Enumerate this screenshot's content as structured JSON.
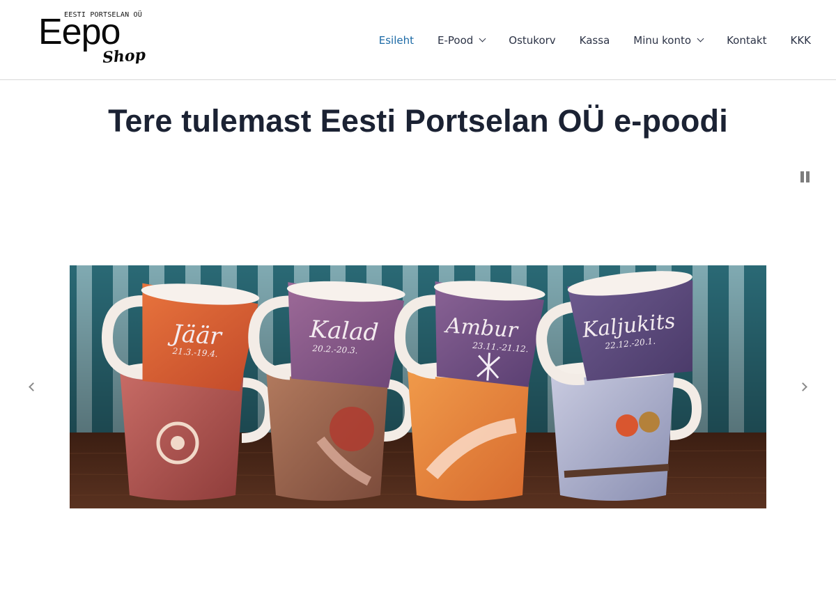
{
  "logo": {
    "top_text": "EESTI PORTSELAN OÜ",
    "main_text": "Eepo",
    "script_text": "Shop"
  },
  "nav": {
    "items": [
      {
        "label": "Esileht",
        "active": true,
        "dropdown": false
      },
      {
        "label": "E-Pood",
        "active": false,
        "dropdown": true
      },
      {
        "label": "Ostukorv",
        "active": false,
        "dropdown": false
      },
      {
        "label": "Kassa",
        "active": false,
        "dropdown": false
      },
      {
        "label": "Minu konto",
        "active": false,
        "dropdown": true
      },
      {
        "label": "Kontakt",
        "active": false,
        "dropdown": false
      },
      {
        "label": "KKK",
        "active": false,
        "dropdown": false
      }
    ]
  },
  "page": {
    "title": "Tere tulemast Eesti Portselan OÜ e-poodi"
  },
  "slider": {
    "pause_icon": "pause-icon",
    "prev_icon": "chevron-left-icon",
    "next_icon": "chevron-right-icon",
    "mugs": [
      {
        "name": "Jäär",
        "date": "21.3.-19.4."
      },
      {
        "name": "Kalad",
        "date": "20.2.-20.3."
      },
      {
        "name": "Ambur",
        "date": "23.11.-21.12."
      },
      {
        "name": "Kaljukits",
        "date": "22.12.-20.1."
      }
    ]
  },
  "colors": {
    "nav_active": "#1c6aa6",
    "nav_text": "#2c3346",
    "title": "#1b2233"
  }
}
